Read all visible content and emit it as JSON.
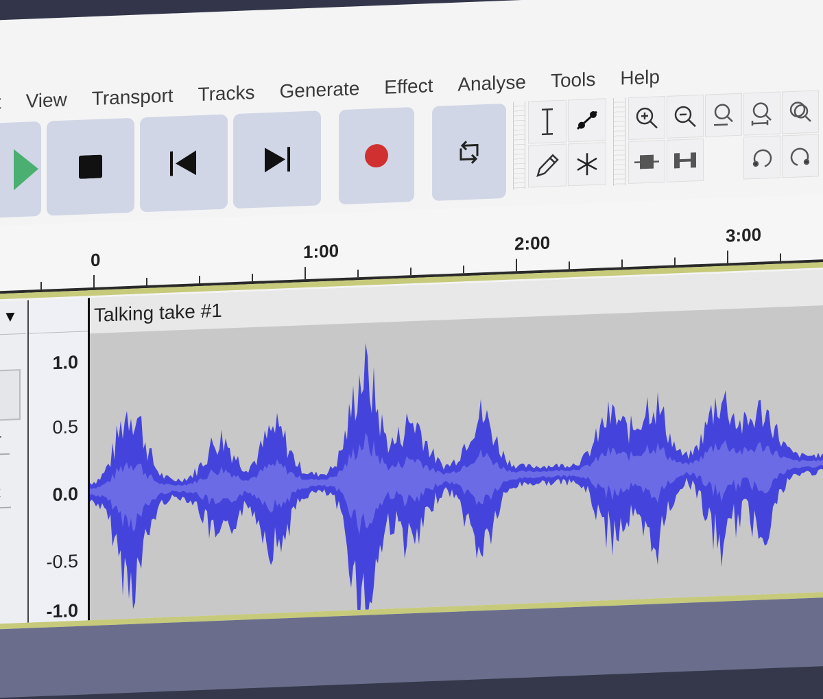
{
  "menubar": {
    "items": [
      "Select",
      "View",
      "Transport",
      "Tracks",
      "Generate",
      "Effect",
      "Analyse",
      "Tools",
      "Help"
    ],
    "visible_first_label": "lect"
  },
  "transport": {
    "buttons": [
      {
        "name": "play",
        "icon": "play-icon",
        "color": "#4caf72"
      },
      {
        "name": "stop",
        "icon": "stop-icon"
      },
      {
        "name": "skip-to-start",
        "icon": "skip-start-icon"
      },
      {
        "name": "skip-to-end",
        "icon": "skip-end-icon"
      },
      {
        "name": "record",
        "icon": "record-icon",
        "color": "#d0302f"
      },
      {
        "name": "loop",
        "icon": "loop-icon"
      }
    ]
  },
  "tools": {
    "edit_tools": [
      "selection-tool",
      "envelope-tool",
      "draw-tool",
      "multi-tool"
    ],
    "zoom_tools": [
      "zoom-in",
      "zoom-out",
      "fit-selection",
      "fit-project",
      "zoom-toggle",
      "trim-audio",
      "silence-audio",
      "",
      "undo",
      "redo"
    ]
  },
  "timeline": {
    "labels": [
      "0",
      "1:00",
      "2:00",
      "3:00"
    ]
  },
  "track": {
    "clip_name": "Talking take #1",
    "menu_arrow": "▼",
    "gain_label": "+",
    "pan_label": "R",
    "amplitude_labels": [
      "1.0",
      "0.5",
      "0.0",
      "-0.5",
      "-1.0"
    ],
    "waveform_color": "#4444dd",
    "waveform_rms_color": "#6b6be6"
  }
}
